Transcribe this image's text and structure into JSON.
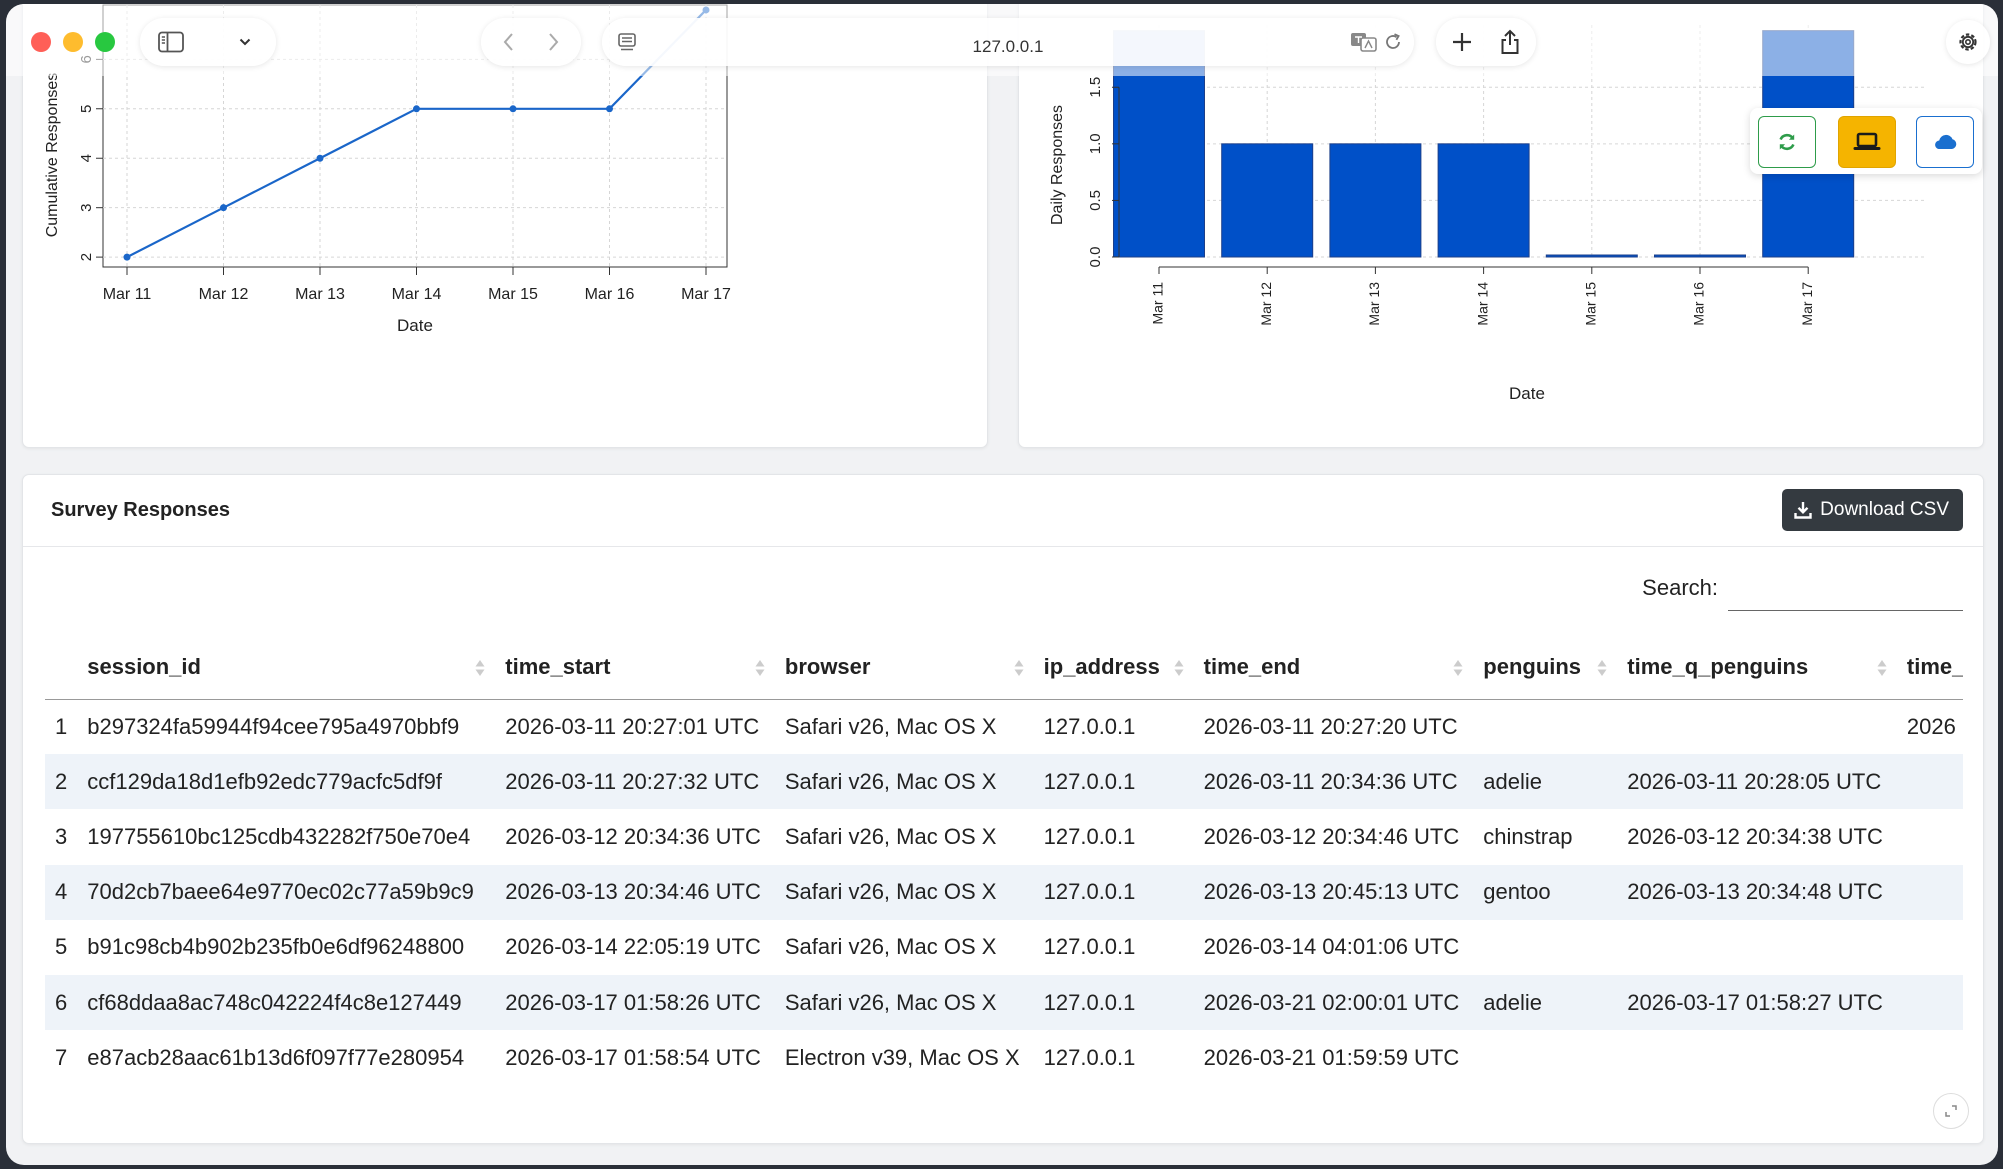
{
  "browser": {
    "url": "127.0.0.1"
  },
  "cumulative_chart": {
    "ylabel": "Cumulative Responses",
    "xlabel": "Date",
    "x_ticks": [
      "Mar 11",
      "Mar 12",
      "Mar 13",
      "Mar 14",
      "Mar 15",
      "Mar 16",
      "Mar 17"
    ],
    "y_ticks": [
      "2",
      "3",
      "4",
      "5",
      "6"
    ]
  },
  "daily_chart": {
    "ylabel": "Daily Responses",
    "xlabel": "Date",
    "x_ticks": [
      "Mar 11",
      "Mar 12",
      "Mar 13",
      "Mar 14",
      "Mar 15",
      "Mar 16",
      "Mar 17"
    ],
    "y_ticks": [
      "0.0",
      "0.5",
      "1.0",
      "1.5"
    ]
  },
  "chart_data": [
    {
      "type": "line",
      "x": [
        "Mar 11",
        "Mar 12",
        "Mar 13",
        "Mar 14",
        "Mar 15",
        "Mar 16",
        "Mar 17"
      ],
      "series": [
        {
          "values": [
            2,
            3,
            4,
            5,
            5,
            5,
            7
          ]
        }
      ],
      "xlabel": "Date",
      "ylabel": "Cumulative Responses",
      "ylim": [
        1.8,
        7.1
      ],
      "grid": true,
      "color": "#1a66c9"
    },
    {
      "type": "bar",
      "categories": [
        "Mar 11",
        "Mar 12",
        "Mar 13",
        "Mar 14",
        "Mar 15",
        "Mar 16",
        "Mar 17"
      ],
      "values": [
        2,
        1,
        1,
        1,
        0,
        0,
        2
      ],
      "xlabel": "Date",
      "ylabel": "Daily Responses",
      "ylim": [
        0,
        2.05
      ],
      "grid": true,
      "color": "#0050c8"
    }
  ],
  "table_card": {
    "title": "Survey Responses",
    "download_label": "Download CSV",
    "search_label": "Search:",
    "search_value": "",
    "columns": [
      "session_id",
      "time_start",
      "browser",
      "ip_address",
      "time_end",
      "penguins",
      "time_q_penguins",
      "time_"
    ],
    "rows": [
      [
        "1",
        "b297324fa59944f94cee795a4970bbf9",
        "2026-03-11 20:27:01 UTC",
        "Safari v26, Mac OS X",
        "127.0.0.1",
        "2026-03-11 20:27:20 UTC",
        "",
        "",
        "2026"
      ],
      [
        "2",
        "ccf129da18d1efb92edc779acfc5df9f",
        "2026-03-11 20:27:32 UTC",
        "Safari v26, Mac OS X",
        "127.0.0.1",
        "2026-03-11 20:34:36 UTC",
        "adelie",
        "2026-03-11 20:28:05 UTC",
        ""
      ],
      [
        "3",
        "197755610bc125cdb432282f750e70e4",
        "2026-03-12 20:34:36 UTC",
        "Safari v26, Mac OS X",
        "127.0.0.1",
        "2026-03-12 20:34:46 UTC",
        "chinstrap",
        "2026-03-12 20:34:38 UTC",
        ""
      ],
      [
        "4",
        "70d2cb7baee64e9770ec02c77a59b9c9",
        "2026-03-13 20:34:46 UTC",
        "Safari v26, Mac OS X",
        "127.0.0.1",
        "2026-03-13 20:45:13 UTC",
        "gentoo",
        "2026-03-13 20:34:48 UTC",
        ""
      ],
      [
        "5",
        "b91c98cb4b902b235fb0e6df96248800",
        "2026-03-14 22:05:19 UTC",
        "Safari v26, Mac OS X",
        "127.0.0.1",
        "2026-03-14 04:01:06 UTC",
        "",
        "",
        ""
      ],
      [
        "6",
        "cf68ddaa8ac748c042224f4c8e127449",
        "2026-03-17 01:58:26 UTC",
        "Safari v26, Mac OS X",
        "127.0.0.1",
        "2026-03-21 02:00:01 UTC",
        "adelie",
        "2026-03-17 01:58:27 UTC",
        ""
      ],
      [
        "7",
        "e87acb28aac61b13d6f097f77e280954",
        "2026-03-17 01:58:54 UTC",
        "Electron v39, Mac OS X",
        "127.0.0.1",
        "2026-03-21 01:59:59 UTC",
        "",
        "",
        ""
      ]
    ]
  },
  "colors": {
    "accent_blue": "#1a66c9",
    "refresh_green": "#2e9c4a",
    "laptop_yellow": "#f5b400",
    "cloud_blue": "#1a6fcf"
  }
}
